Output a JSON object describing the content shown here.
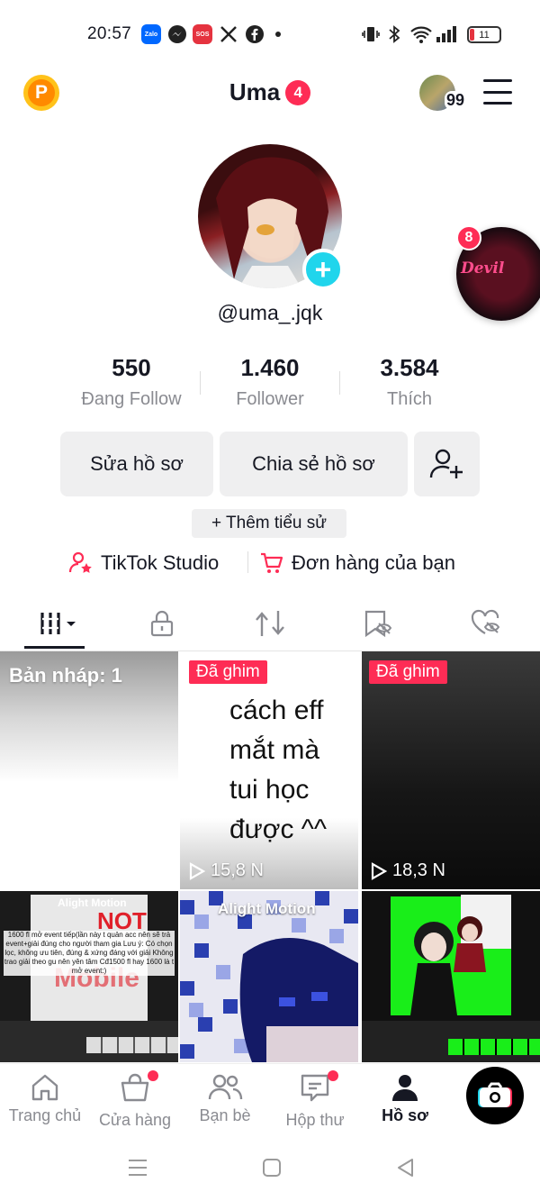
{
  "status_bar": {
    "time": "20:57",
    "notif_icons": [
      "zalo-icon",
      "messenger-icon",
      "sos-icon",
      "x-icon",
      "facebook-icon",
      "more-dot-icon"
    ],
    "zalo_label": "Zalo",
    "sos_label": "SOS",
    "battery": "11"
  },
  "header": {
    "username": "Uma",
    "notification_count": "4",
    "story_count": "99"
  },
  "profile": {
    "handle": "@uma_.jqk",
    "bubble_badge": "8",
    "bubble_text": "Devil"
  },
  "stats": [
    {
      "value": "550",
      "label": "Đang Follow"
    },
    {
      "value": "1.460",
      "label": "Follower"
    },
    {
      "value": "3.584",
      "label": "Thích"
    }
  ],
  "actions": {
    "edit": "Sửa hồ sơ",
    "share": "Chia sẻ hồ sơ",
    "add_bio": "+ Thêm tiểu sử"
  },
  "links": {
    "studio": "TikTok Studio",
    "orders": "Đơn hàng của bạn"
  },
  "tabs": [
    "videos-grid-icon",
    "lock-icon",
    "repost-icon",
    "saved-icon",
    "liked-icon"
  ],
  "grid": {
    "drafts": "Bản nháp: 1",
    "pinned": "Đã ghim",
    "video2_text": [
      "cách eff",
      "mắt mà",
      "tui học",
      "được ^^"
    ],
    "video2_views": "15,8 N",
    "video3_views": "18,3 N",
    "video4_not": "NOT",
    "video4_body": "1600 fl mở event tiếp(lần này t quản acc nên sẽ trả event+giải đúng cho người tham gia Lưu ý: Có chọn lọc, không ưu tiên, đúng & xứng đáng với giải Không trao giải theo gu nên yên tâm Cđ1500 fl hay 1600 là t mở event:)",
    "video4_mobile": "Mobile",
    "video5_watermark": "Alight Motion",
    "video4_watermark": "Alight Motion"
  },
  "bottom_nav": [
    {
      "label": "Trang chủ",
      "icon": "home-icon"
    },
    {
      "label": "Cửa hàng",
      "icon": "shop-icon"
    },
    {
      "label": "Bạn bè",
      "icon": "friends-icon"
    },
    {
      "label": "Hộp thư",
      "icon": "inbox-icon"
    },
    {
      "label": "Hồ sơ",
      "icon": "profile-icon"
    }
  ],
  "colors": {
    "accent": "#fe2c55",
    "cyan": "#20d5ec",
    "text": "#161823",
    "muted": "#8a8b91"
  }
}
